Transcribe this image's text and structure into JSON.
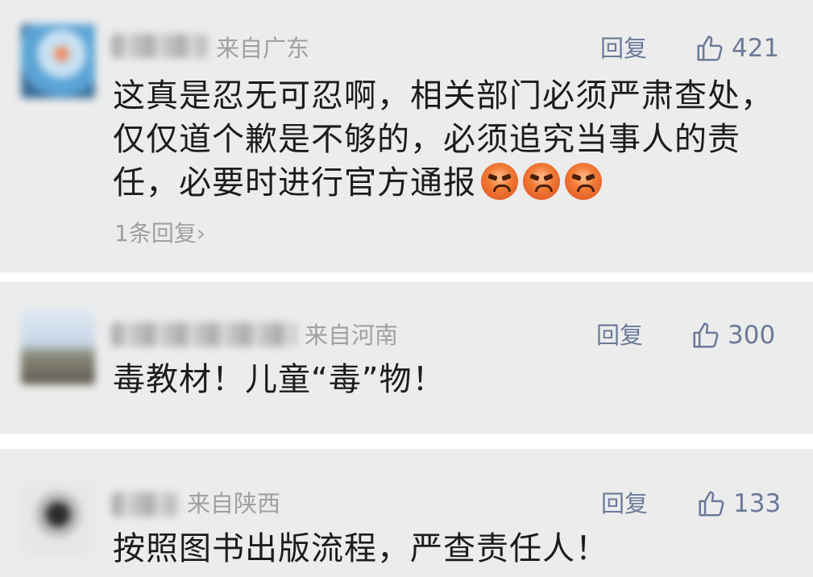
{
  "comments": [
    {
      "location": "来自广东",
      "reply_label": "回复",
      "like_count": "421",
      "text_line1": "这真是忍无可忍啊，相关部门必须严肃查处，",
      "text_line2": "仅仅道个歉是不够的，必须追究当事人的责",
      "text_line3": "任，必要时进行官方通报",
      "emoji_count": 3,
      "sub_replies": "1条回复›"
    },
    {
      "location": "来自河南",
      "reply_label": "回复",
      "like_count": "300",
      "text": "毒教材！儿童“毒”物！"
    },
    {
      "location": "来自陕西",
      "reply_label": "回复",
      "like_count": "133",
      "text": "按照图书出版流程，严查责任人！"
    }
  ],
  "icons": {
    "like": "thumbs-up-icon",
    "emoji": "angry-face-emoji"
  },
  "colors": {
    "panel_bg": "#ececec",
    "link_color": "#6b7a99",
    "meta_gray": "#a0a0a0",
    "text": "#1c1c1c"
  }
}
